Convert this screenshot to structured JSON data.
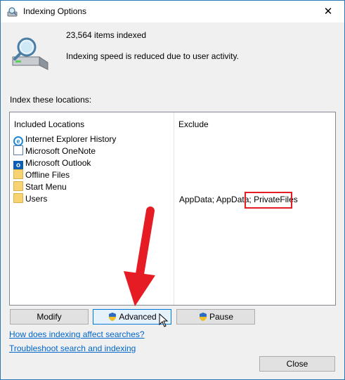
{
  "window": {
    "title": "Indexing Options"
  },
  "summary": {
    "items_indexed": "23,564 items indexed",
    "status": "Indexing speed is reduced due to user activity."
  },
  "locations": {
    "section_label": "Index these locations:",
    "col_included": "Included Locations",
    "col_exclude": "Exclude",
    "rows": [
      {
        "name": "Internet Explorer History",
        "icon": "internet-explorer-icon",
        "exclude": ""
      },
      {
        "name": "Microsoft OneNote",
        "icon": "onenote-icon",
        "exclude": ""
      },
      {
        "name": "Microsoft Outlook",
        "icon": "outlook-icon",
        "exclude": ""
      },
      {
        "name": "Offline Files",
        "icon": "folder-icon",
        "exclude": ""
      },
      {
        "name": "Start Menu",
        "icon": "folder-icon",
        "exclude": ""
      },
      {
        "name": "Users",
        "icon": "folder-icon",
        "exclude": "AppData; AppData; PrivateFiles"
      }
    ],
    "exclude_prefix": "AppData; AppData; ",
    "exclude_highlight": "PrivateFiles"
  },
  "buttons": {
    "modify": "Modify",
    "advanced": "Advanced",
    "pause": "Pause",
    "close": "Close"
  },
  "links": {
    "how_indexing": "How does indexing affect searches?",
    "troubleshoot": "Troubleshoot search and indexing"
  },
  "colors": {
    "annotation_red": "#e51c23",
    "link_blue": "#0066cc",
    "window_border": "#2b78b4"
  }
}
